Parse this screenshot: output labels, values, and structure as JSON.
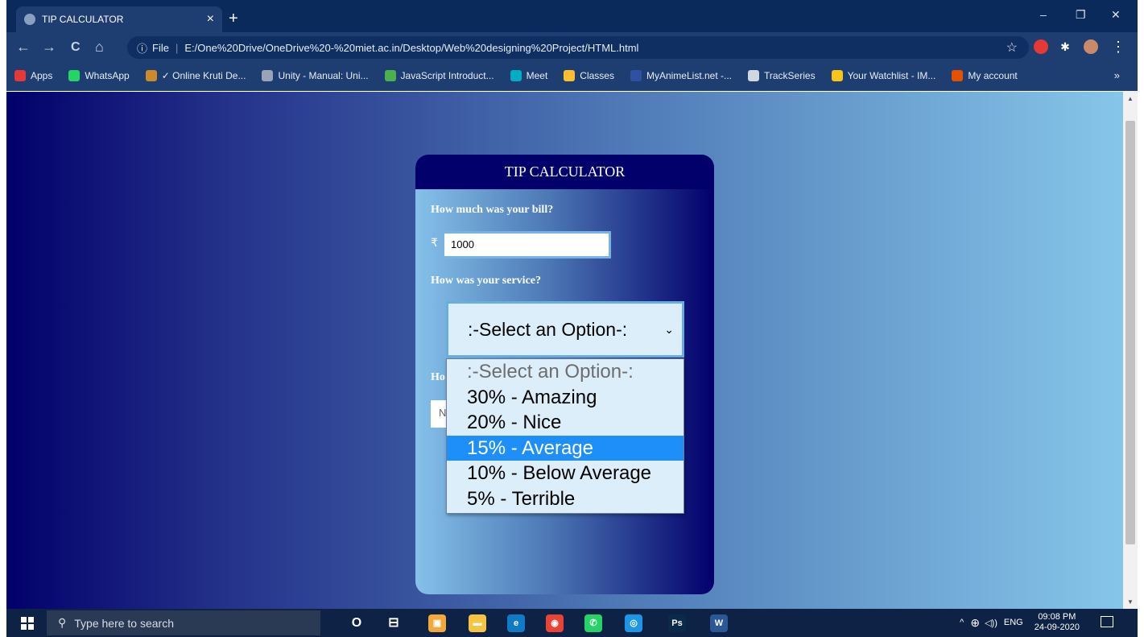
{
  "browser": {
    "tab_title": "TIP CALCULATOR",
    "tab_close": "×",
    "new_tab": "+",
    "window_minimize": "–",
    "window_restore": "❐",
    "window_close": "✕",
    "back": "←",
    "forward": "→",
    "reload": "C",
    "home": "⌂",
    "info": "ⓘ",
    "file_label": "File",
    "url": "E:/One%20Drive/OneDrive%20-%20miet.ac.in/Desktop/Web%20designing%20Project/HTML.html",
    "star": "☆",
    "menu": "⋮"
  },
  "bookmarks": [
    {
      "label": "Apps",
      "color": "#e53935"
    },
    {
      "label": "WhatsApp",
      "color": "#25d366"
    },
    {
      "label": "✓ Online Kruti De...",
      "color": "#c98b2b"
    },
    {
      "label": "Unity - Manual: Uni...",
      "color": "#9aa4b8"
    },
    {
      "label": "JavaScript Introduct...",
      "color": "#4caf50"
    },
    {
      "label": "Meet",
      "color": "#00acc1"
    },
    {
      "label": "Classes",
      "color": "#fbc02d"
    },
    {
      "label": "MyAnimeList.net -...",
      "color": "#2e51a2"
    },
    {
      "label": "TrackSeries",
      "color": "#cfd8dc"
    },
    {
      "label": "Your Watchlist - IM...",
      "color": "#f5c518"
    },
    {
      "label": "My account",
      "color": "#e65100"
    }
  ],
  "bookmarks_more": "»",
  "card": {
    "title": "TIP CALCULATOR",
    "bill_question": "How much was your bill?",
    "currency_symbol": "₹",
    "bill_value": "1000",
    "service_question": "How was your service?",
    "select_value": ":-Select an Option-:",
    "hidden_question_stub": "Ho",
    "hidden_input_stub": "N"
  },
  "dropdown": {
    "options": [
      ":-Select an Option-:",
      "30% - Amazing",
      "20% - Nice",
      "15% - Average",
      "10% - Below Average",
      "5% - Terrible"
    ],
    "highlighted_index": 3
  },
  "taskbar": {
    "search_placeholder": "Type here to search",
    "apps": [
      {
        "name": "cortana",
        "glyph": "O",
        "color": "transparent"
      },
      {
        "name": "task-view",
        "glyph": "⊟",
        "color": "transparent"
      },
      {
        "name": "store",
        "glyph": "▣",
        "color": "#f2a93b"
      },
      {
        "name": "file-explorer",
        "glyph": "▬",
        "color": "#f6c343"
      },
      {
        "name": "edge",
        "glyph": "e",
        "color": "#0f7bc4"
      },
      {
        "name": "chrome",
        "glyph": "◉",
        "color": "#e84335"
      },
      {
        "name": "whatsapp",
        "glyph": "✆",
        "color": "#25d366"
      },
      {
        "name": "instagram",
        "glyph": "◎",
        "color": "#1c96e6"
      },
      {
        "name": "photoshop",
        "glyph": "Ps",
        "color": "#0a2a4a"
      },
      {
        "name": "word",
        "glyph": "W",
        "color": "#2b5797"
      }
    ],
    "tray_up": "^",
    "tray_network": "⊕",
    "tray_volume": "◁))",
    "language": "ENG",
    "time": "09:08 PM",
    "date": "24-09-2020"
  }
}
